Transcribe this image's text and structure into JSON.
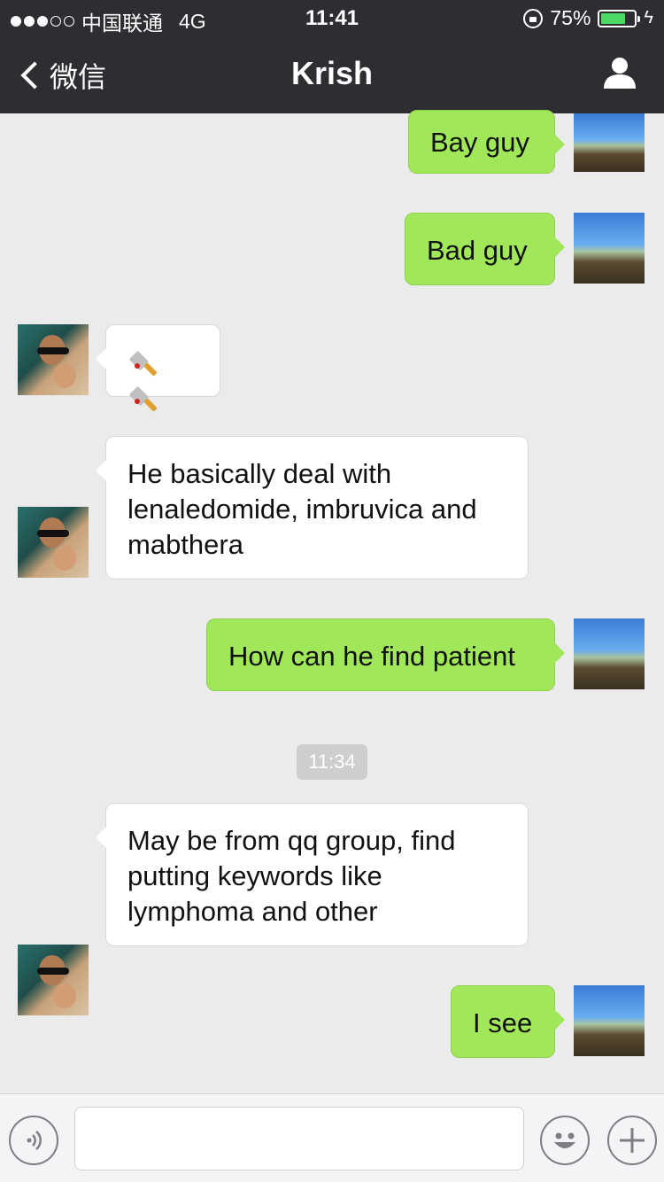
{
  "status_bar": {
    "carrier": "中国联通",
    "network": "4G",
    "time": "11:41",
    "battery": "75%",
    "battery_level": 0.75,
    "signal_bars_filled": 3,
    "signal_bars_total": 5
  },
  "nav": {
    "back_label": "微信",
    "title": "Krish"
  },
  "messages": [
    {
      "from": "me",
      "text": "Bay guy"
    },
    {
      "from": "me",
      "text": "Bad guy"
    },
    {
      "from": "them",
      "text": "🔪🔪"
    },
    {
      "from": "them",
      "lines": [
        "He basically deal with",
        "lenaledomide, imbruvica and",
        "mabthera"
      ]
    },
    {
      "from": "me",
      "text": "How can he find patient"
    },
    {
      "from": "them",
      "lines": [
        "May be from qq group, find",
        "putting keywords like",
        "lymphoma and other"
      ]
    },
    {
      "from": "me",
      "text": "I see"
    }
  ],
  "timestamp": "11:34",
  "input": {
    "value": "",
    "placeholder": ""
  },
  "icons": [
    "back-chevron-icon",
    "person-icon",
    "voice-icon",
    "emoji-icon",
    "plus-icon",
    "lock-rotation-icon",
    "battery-icon",
    "charging-bolt-icon"
  ],
  "colors": {
    "nav_bg": "#2e2e32",
    "chat_bg": "#ebebeb",
    "my_bubble": "#a0e75a",
    "their_bubble": "#ffffff",
    "battery_fill": "#4cd964"
  }
}
